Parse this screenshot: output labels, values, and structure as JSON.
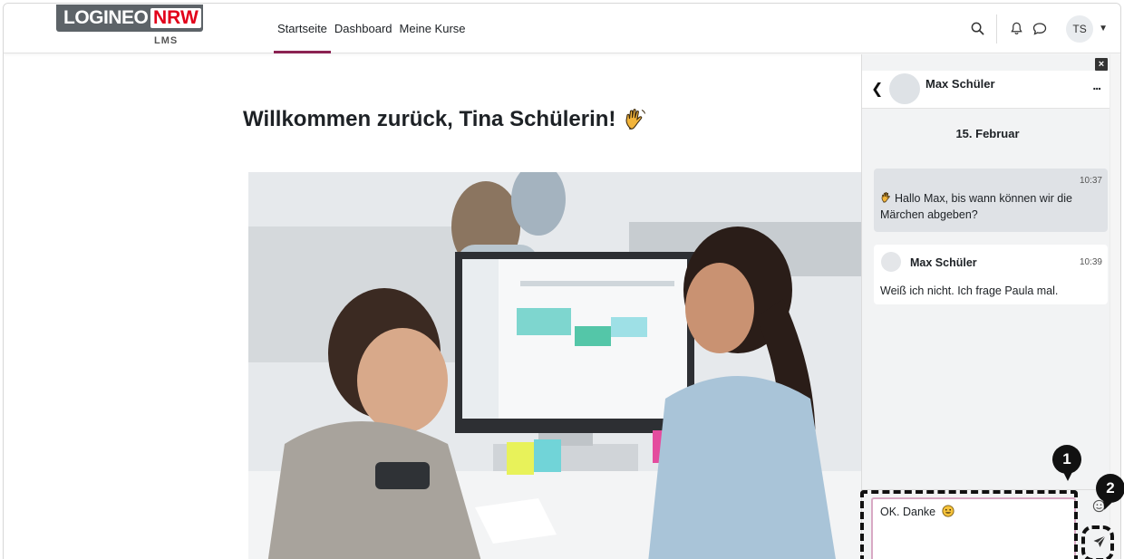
{
  "brand": {
    "word": "LOGINEO",
    "accent": "NRW",
    "sub": "LMS"
  },
  "nav": {
    "items": [
      {
        "label": "Startseite",
        "active": true
      },
      {
        "label": "Dashboard",
        "active": false
      },
      {
        "label": "Meine Kurse",
        "active": false
      }
    ],
    "user_initials": "TS"
  },
  "main": {
    "welcome": "Willkommen zurück, Tina Schülerin!"
  },
  "drawer": {
    "contact_name": "Max Schüler",
    "more_label": "...",
    "date": "15. Februar",
    "messages": [
      {
        "time": "10:37",
        "text": "Hallo Max, bis wann können wir die Märchen abgeben?"
      },
      {
        "sender": "Max Schüler",
        "time": "10:39",
        "text": "Weiß ich nicht. Ich frage Paula mal."
      }
    ],
    "compose_value": "OK. Danke"
  },
  "callouts": {
    "one": "1",
    "two": "2"
  },
  "colors": {
    "accent": "#8b2252",
    "nrw_red": "#e2001a",
    "drawer_bg": "#f2f3f4",
    "own_bubble": "#dfe2e6"
  }
}
